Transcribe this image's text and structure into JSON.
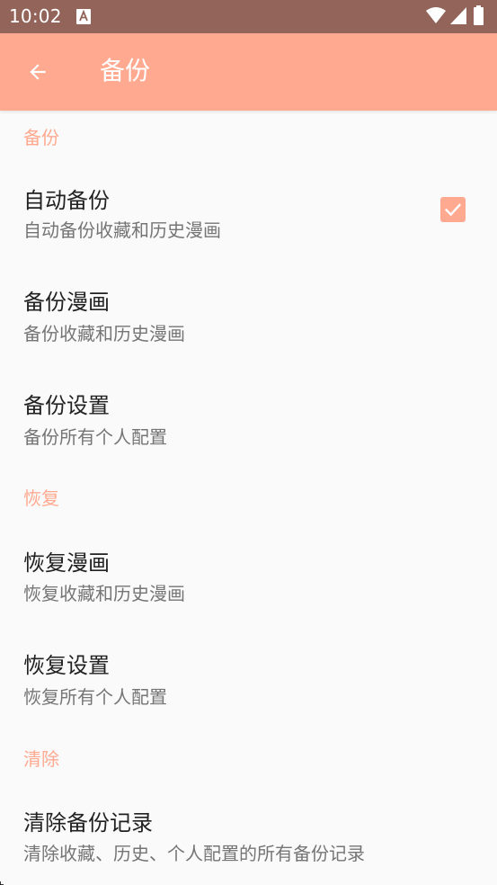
{
  "status_bar": {
    "time": "10:02",
    "background": "#93645a",
    "icons": [
      "a-notification-icon",
      "wifi-icon",
      "signal-icon",
      "battery-icon"
    ]
  },
  "app_bar": {
    "title": "备份",
    "background": "#ffaa90",
    "back_icon": "arrow-back-icon"
  },
  "accent_color": "#ffaa90",
  "sections": {
    "backup": {
      "header": "备份",
      "auto_backup": {
        "title": "自动备份",
        "summary": "自动备份收藏和历史漫画",
        "checked": true
      },
      "backup_comics": {
        "title": "备份漫画",
        "summary": "备份收藏和历史漫画"
      },
      "backup_settings": {
        "title": "备份设置",
        "summary": "备份所有个人配置"
      }
    },
    "restore": {
      "header": "恢复",
      "restore_comics": {
        "title": "恢复漫画",
        "summary": "恢复收藏和历史漫画"
      },
      "restore_settings": {
        "title": "恢复设置",
        "summary": "恢复所有个人配置"
      }
    },
    "clear": {
      "header": "清除",
      "clear_records": {
        "title": "清除备份记录",
        "summary": "清除收藏、历史、个人配置的所有备份记录"
      }
    }
  }
}
